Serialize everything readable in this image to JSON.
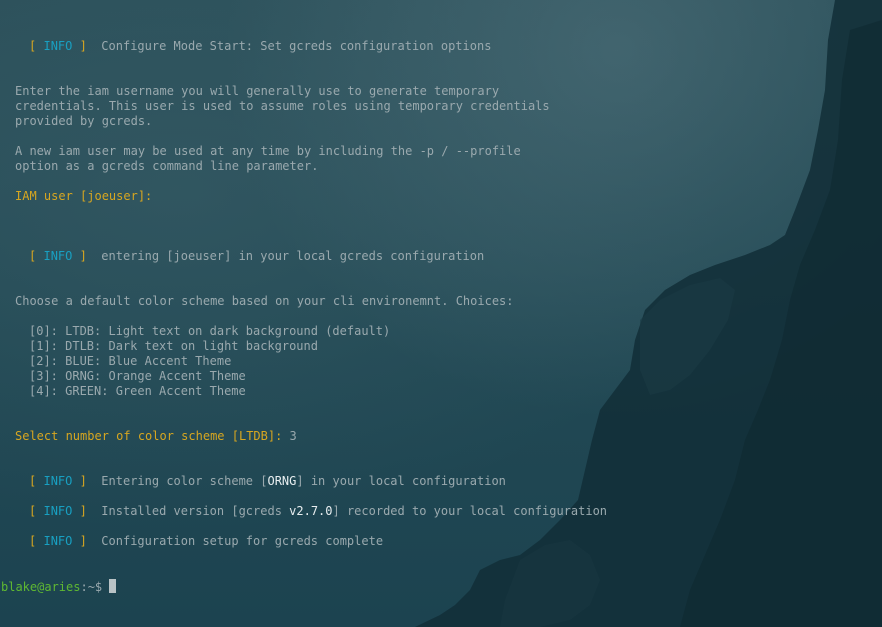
{
  "info_tag": {
    "open": "[",
    "label": "INFO",
    "close": "]"
  },
  "messages": {
    "configure_start": "Configure Mode Start: Set gcreds configuration options",
    "entering_user_prefix": "entering [",
    "entering_user_value": "joeuser",
    "entering_user_suffix": "] in your local gcreds configuration",
    "color_prefix": "Entering color scheme [",
    "color_value": "ORNG",
    "color_suffix": "] in your local configuration",
    "version_prefix": "Installed version [gcreds ",
    "version_value": "v2.7.0",
    "version_suffix": "] recorded to your local configuration",
    "setup_complete": "Configuration setup for gcreds complete"
  },
  "iam_help": [
    "Enter the iam username you will generally use to generate temporary",
    "credentials. This user is used to assume roles using temporary credentials",
    "provided by gcreds.",
    "A new iam user may be used at any time by including the -p / --profile",
    "option as a gcreds command line parameter."
  ],
  "iam_prompt": "IAM user [joeuser]:",
  "color_choice_intro": "Choose a default color scheme based on your cli environemnt. Choices:",
  "color_choices": [
    "[0]: LTDB: Light text on dark background (default)",
    "[1]: DTLB: Dark text on light background",
    "[2]: BLUE: Blue Accent Theme",
    "[3]: ORNG: Orange Accent Theme",
    "[4]: GREEN: Green Accent Theme"
  ],
  "color_prompt": "Select number of color scheme [LTDB]:",
  "color_answer": "3",
  "shell_prompt": {
    "user_host": "blake@aries",
    "path": ":~$"
  },
  "colors": {
    "prompt_yellow": "#d7a620",
    "info_cyan": "#18a0c2",
    "text_grey": "#9aa9ae",
    "prompt_green": "#5fb832",
    "background": "#1f4a55"
  }
}
